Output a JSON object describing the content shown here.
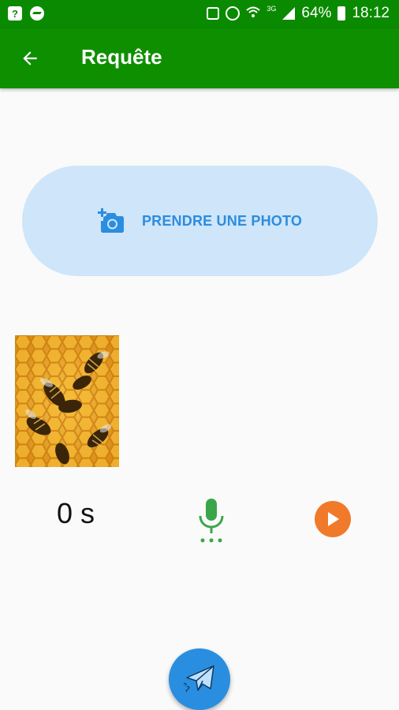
{
  "status_bar": {
    "battery": "64%",
    "time": "18:12",
    "network_label": "3G",
    "notification_icons": [
      "unknown-app-icon",
      "messenger-icon"
    ],
    "system_icons": [
      "screenshot-icon",
      "alarm-icon",
      "wifi-icon",
      "signal-icon",
      "battery-icon"
    ]
  },
  "app_bar": {
    "title": "Requête",
    "back_icon": "arrow-back-icon",
    "color": "#0e8f00"
  },
  "photo_button": {
    "label": "PRENDRE UNE PHOTO",
    "icon": "add-a-photo-icon",
    "background": "#cfe5f9",
    "text_color": "#2b8de0"
  },
  "thumbnail": {
    "description_icon": "bees-on-honeycomb-image"
  },
  "recording": {
    "duration": "0 s",
    "mic_icon": "mic-icon",
    "play_icon": "play-icon",
    "mic_color": "#3aa64a",
    "play_color": "#f07a2a"
  },
  "send_button": {
    "icon": "paper-plane-icon",
    "color": "#2a8ee0"
  },
  "sb_q": "?"
}
